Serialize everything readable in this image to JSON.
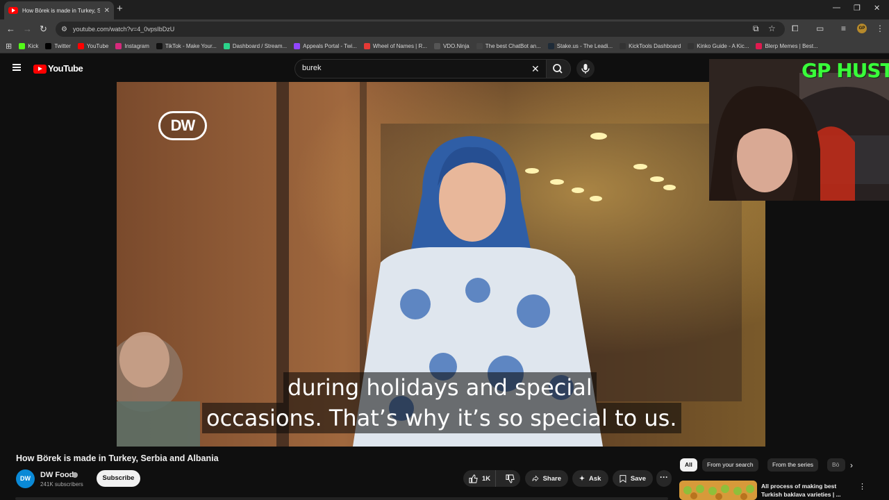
{
  "browser": {
    "tab_title": "How Börek is made in Turkey, S",
    "url": "youtube.com/watch?v=4_0vpsIbDzU",
    "profile_initials": "GP",
    "bookmarks": [
      {
        "label": "Kick",
        "color": "#53fc18",
        "icon": "kick-icon"
      },
      {
        "label": "Twitter",
        "color": "#000000",
        "icon": "x-icon"
      },
      {
        "label": "YouTube",
        "color": "#ff0000",
        "icon": "youtube-icon"
      },
      {
        "label": "Instagram",
        "color": "#d6297c",
        "icon": "instagram-icon"
      },
      {
        "label": "TikTok - Make Your...",
        "color": "#111111",
        "icon": "tiktok-icon"
      },
      {
        "label": "Dashboard / Stream...",
        "color": "#2bd38a",
        "icon": "stream-icon"
      },
      {
        "label": "Appeals Portal - Twi...",
        "color": "#9146ff",
        "icon": "twitch-icon"
      },
      {
        "label": "Wheel of Names | R...",
        "color": "#e53935",
        "icon": "wheel-icon"
      },
      {
        "label": "VDO.Ninja",
        "color": "#555555",
        "icon": "ninja-icon"
      },
      {
        "label": "The best ChatBot an...",
        "color": "#444444",
        "icon": "chatbot-icon"
      },
      {
        "label": "Stake.us - The Leadi...",
        "color": "#1e2b38",
        "icon": "stake-icon"
      },
      {
        "label": "KickTools Dashboard",
        "color": "#333333",
        "icon": "grid-icon"
      },
      {
        "label": "Kinko Guide - A Kic...",
        "color": "#333333",
        "icon": "grid-icon"
      },
      {
        "label": "Blerp Memes | Best...",
        "color": "#e01a4f",
        "icon": "blerp-icon"
      }
    ]
  },
  "youtube": {
    "logo_text": "YouTube",
    "search_query": "burek",
    "video": {
      "caption_line1": "during holidays and special",
      "caption_line2": "occasions. That’s why it’s so special to us.",
      "watermark": "DW"
    },
    "webcam_overlay_text": "GP HUSTLA",
    "title": "How Börek is made in Turkey, Serbia and Albania",
    "channel": {
      "avatar_text": "DW",
      "name": "DW Food",
      "subscribers": "241K subscribers",
      "subscribe_label": "Subscribe"
    },
    "actions": {
      "like_count": "1K",
      "share_label": "Share",
      "ask_label": "Ask",
      "save_label": "Save"
    },
    "chips": [
      "All",
      "From your search",
      "From the series",
      "Bö"
    ],
    "recommended": {
      "title": "All process of making best Turkish baklava varieties | ..."
    }
  }
}
